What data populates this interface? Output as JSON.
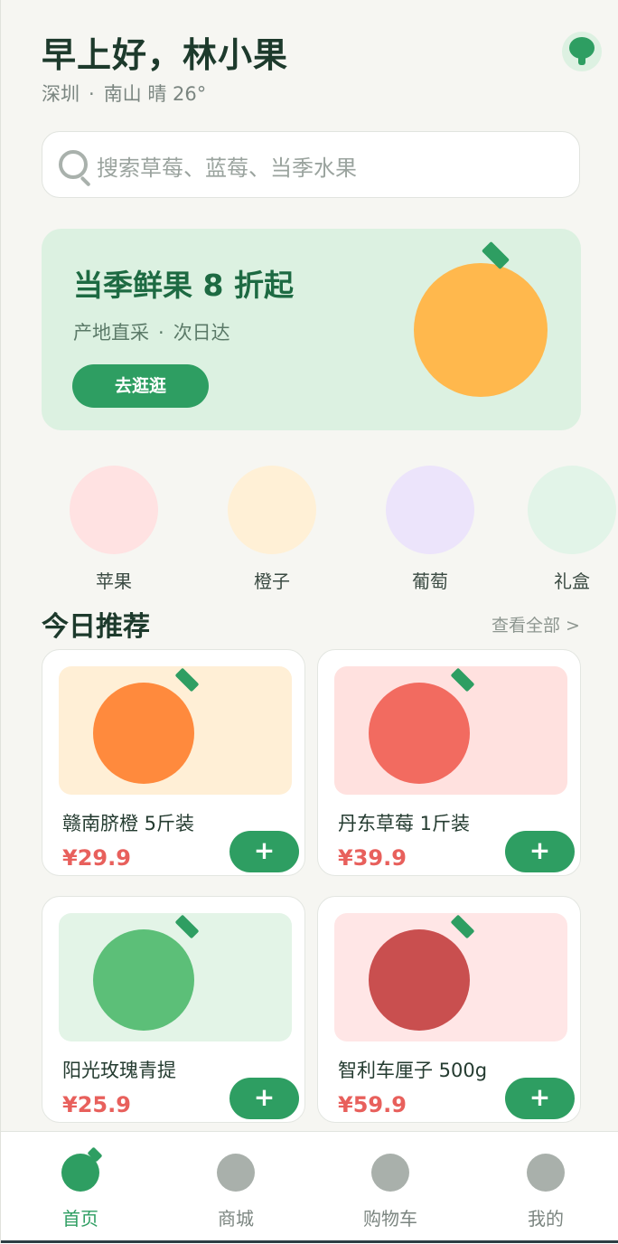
{
  "header": {
    "greeting": "早上好，林小果",
    "city": "深圳",
    "separator": "·",
    "weather": "南山 晴 26°"
  },
  "search": {
    "placeholder": "搜索草莓、蓝莓、当季水果"
  },
  "banner": {
    "title": "当季鲜果 8 折起",
    "sub_left": "产地直采",
    "sub_right": "次日达",
    "cta": "去逛逛",
    "fruit_color": "#ffb84d"
  },
  "categories": [
    {
      "label": "苹果",
      "color": "#ffe2e2"
    },
    {
      "label": "橙子",
      "color": "#fff0d6"
    },
    {
      "label": "葡萄",
      "color": "#ece4fb"
    },
    {
      "label": "礼盒",
      "color": "#e2f4e8"
    }
  ],
  "section": {
    "title": "今日推荐",
    "see_all": "查看全部 >"
  },
  "products": [
    {
      "name": "赣南脐橙 5斤装",
      "price": "¥29.9",
      "bg": "#ffefd6",
      "fruit": "#ff8a3d",
      "add": "+"
    },
    {
      "name": "丹东草莓 1斤装",
      "price": "¥39.9",
      "bg": "#ffe1df",
      "fruit": "#f26b60",
      "add": "+"
    },
    {
      "name": "阳光玫瑰青提",
      "price": "¥25.9",
      "bg": "#e3f4e7",
      "fruit": "#5cbf78",
      "add": "+"
    },
    {
      "name": "智利车厘子 500g",
      "price": "¥59.9",
      "bg": "#ffe6e6",
      "fruit": "#c94f4f",
      "add": "+"
    }
  ],
  "nav": [
    {
      "label": "首页",
      "icon": "home-icon",
      "active": true
    },
    {
      "label": "商城",
      "icon": "shop-icon",
      "active": false
    },
    {
      "label": "购物车",
      "icon": "cart-icon",
      "active": false
    },
    {
      "label": "我的",
      "icon": "profile-icon",
      "active": false
    }
  ],
  "colors": {
    "accent": "#2e9e62",
    "price": "#e8605c",
    "background": "#f6f6f2"
  }
}
